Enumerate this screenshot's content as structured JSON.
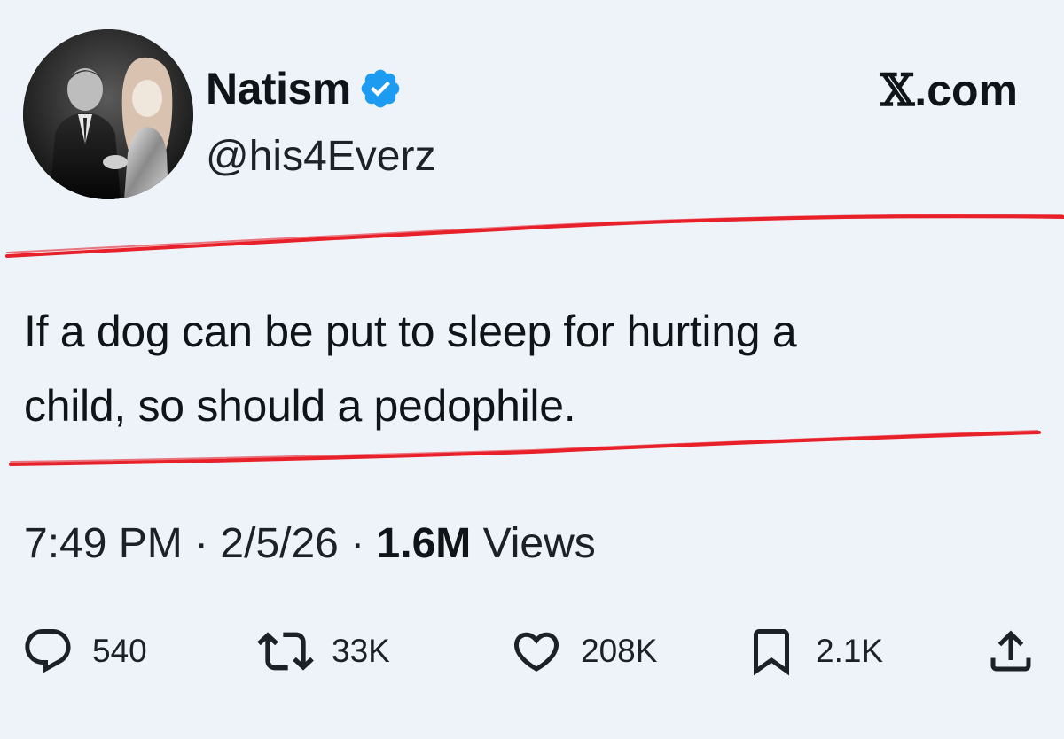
{
  "author": {
    "display_name": "Natism",
    "handle": "@his4Everz",
    "verified_icon": "verified-badge-icon"
  },
  "site": {
    "x_letter": "𝕏",
    "domain": ".com"
  },
  "tweet": {
    "line1": "If a dog can be put to sleep for hurting a",
    "line2": "child, so should a pedophile."
  },
  "meta": {
    "time": "7:49 PM",
    "sep1": " · ",
    "date": "2/5/26",
    "sep2": " · ",
    "views_count": "1.6M",
    "views_label": " Views"
  },
  "actions": {
    "replies": "540",
    "reposts": "33K",
    "likes": "208K",
    "bookmarks": "2.1K"
  },
  "colors": {
    "background": "#eef3f9",
    "verified_blue": "#1d9bf0",
    "annotation_red": "#e8202a"
  }
}
